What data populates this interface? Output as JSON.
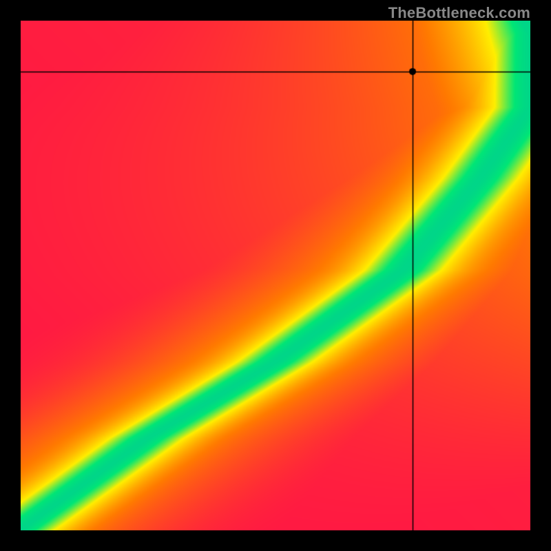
{
  "watermark": "TheBottleneck.com",
  "chart_data": {
    "type": "heatmap",
    "title": "",
    "xlabel": "",
    "ylabel": "",
    "xlim": [
      0,
      1
    ],
    "ylim": [
      0,
      1
    ],
    "marker": {
      "x": 0.77,
      "y": 0.9
    },
    "crosshair": {
      "x": 0.77,
      "y": 0.9
    },
    "color_scale": [
      {
        "t": 0.0,
        "hex": "#ff1744"
      },
      {
        "t": 0.35,
        "hex": "#ff7a00"
      },
      {
        "t": 0.7,
        "hex": "#ffee00"
      },
      {
        "t": 0.92,
        "hex": "#00e676"
      },
      {
        "t": 1.0,
        "hex": "#00d688"
      }
    ],
    "ridge_width": 0.065,
    "field_description": "Heatmap value depends on distance from a ridge curve running from bottom-left to top-right. Along the ridge the value is maximal (green); far from it the value is minimal (red). Independently, the top-right corner is also pulled toward green/yellow."
  }
}
